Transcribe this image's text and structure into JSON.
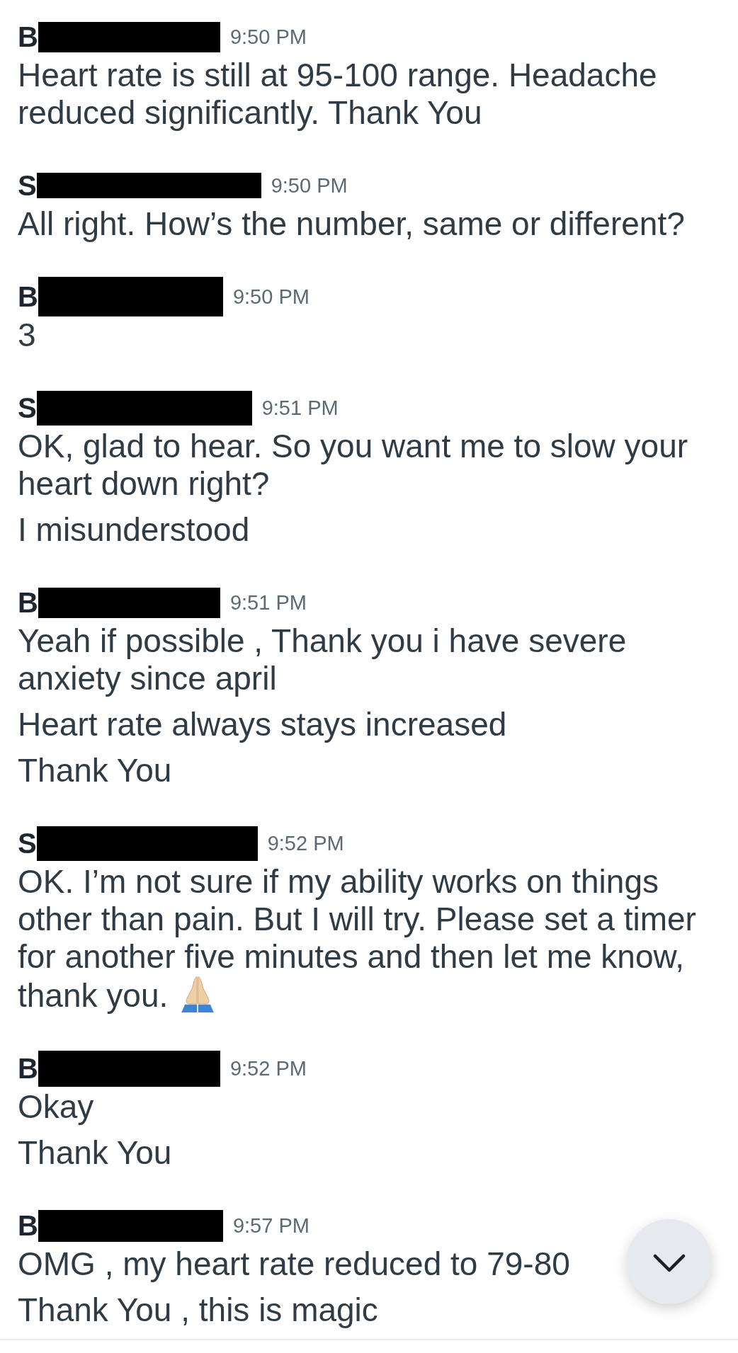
{
  "messages": [
    {
      "sender": "B",
      "name_redacted": true,
      "time": "9:50 PM",
      "emoji": false,
      "paragraphs": [
        "Heart rate is still at 95-100 range. Headache reduced significantly. Thank You"
      ]
    },
    {
      "sender": "S",
      "name_redacted": true,
      "time": "9:50 PM",
      "emoji": false,
      "paragraphs": [
        "All right. How’s the number, same or different?"
      ]
    },
    {
      "sender": "B",
      "name_redacted": true,
      "time": "9:50 PM",
      "emoji": false,
      "paragraphs": [
        "3"
      ]
    },
    {
      "sender": "S",
      "name_redacted": true,
      "time": "9:51 PM",
      "emoji": false,
      "paragraphs": [
        "OK, glad to hear. So you want me to slow your heart down right?",
        "I misunderstood"
      ]
    },
    {
      "sender": "B",
      "name_redacted": true,
      "time": "9:51 PM",
      "emoji": false,
      "paragraphs": [
        "Yeah if possible , Thank you i have severe anxiety since april",
        "Heart rate always stays increased",
        "Thank You"
      ]
    },
    {
      "sender": "S",
      "name_redacted": true,
      "time": "9:52 PM",
      "emoji": true,
      "paragraphs": [
        "OK. I’m not sure if my ability works on things other than pain. But I will try. Please set a timer for another five minutes and then let me know, thank you."
      ]
    },
    {
      "sender": "B",
      "name_redacted": true,
      "time": "9:52 PM",
      "emoji": false,
      "paragraphs": [
        "Okay",
        "Thank You"
      ]
    },
    {
      "sender": "B",
      "name_redacted": true,
      "time": "9:57 PM",
      "emoji": false,
      "paragraphs": [
        "OMG , my heart rate reduced to 79-80",
        "Thank You , this is magic"
      ]
    }
  ]
}
